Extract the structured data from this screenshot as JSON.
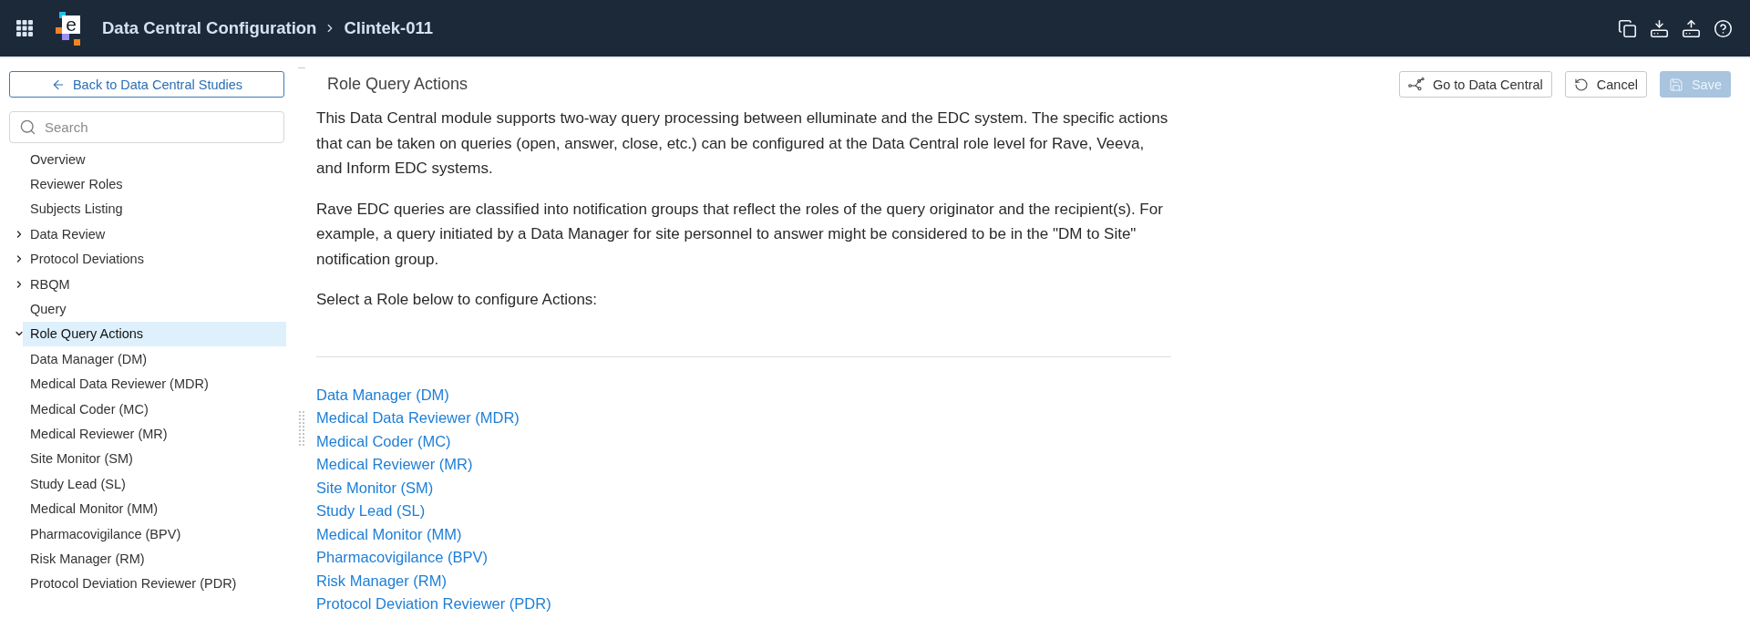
{
  "header": {
    "logo_letter": "e",
    "breadcrumb": [
      "Data Central Configuration",
      "Clintek-011"
    ]
  },
  "sidebar": {
    "back_button": "Back to Data Central Studies",
    "search": {
      "placeholder": "Search"
    },
    "nav": [
      {
        "label": "Overview",
        "kind": "link",
        "selected": false
      },
      {
        "label": "Reviewer Roles",
        "kind": "link",
        "selected": false
      },
      {
        "label": "Subjects Listing",
        "kind": "link",
        "selected": false
      },
      {
        "label": "Data Review",
        "kind": "group",
        "expanded": false,
        "selected": false
      },
      {
        "label": "Protocol Deviations",
        "kind": "group",
        "expanded": false,
        "selected": false
      },
      {
        "label": "RBQM",
        "kind": "group",
        "expanded": false,
        "selected": false
      },
      {
        "label": "Query",
        "kind": "link",
        "selected": false
      },
      {
        "label": "Role Query Actions",
        "kind": "group",
        "expanded": true,
        "selected": true,
        "children": [
          {
            "label": "Data Manager (DM)",
            "selected": false
          },
          {
            "label": "Medical Data Reviewer (MDR)",
            "selected": false
          },
          {
            "label": "Medical Coder (MC)",
            "selected": false
          },
          {
            "label": "Medical Reviewer (MR)",
            "selected": false
          },
          {
            "label": "Site Monitor (SM)",
            "selected": false
          },
          {
            "label": "Study Lead (SL)",
            "selected": false
          },
          {
            "label": "Medical Monitor (MM)",
            "selected": false
          },
          {
            "label": "Pharmacovigilance (BPV)",
            "selected": false
          },
          {
            "label": "Risk Manager (RM)",
            "selected": false
          },
          {
            "label": "Protocol Deviation Reviewer (PDR)",
            "selected": false
          }
        ]
      }
    ]
  },
  "main": {
    "title": "Role Query Actions",
    "actions": [
      {
        "label": "Go to Data Central",
        "kind": "outline",
        "disabled": false
      },
      {
        "label": "Cancel",
        "kind": "outline",
        "disabled": false
      },
      {
        "label": "Save",
        "kind": "primary",
        "disabled": true
      }
    ],
    "paragraphs": [
      "This Data Central module supports two-way query processing between elluminate and the EDC system. The specific actions that can be taken on queries (open, answer, close, etc.) can be configured at the Data Central role level for Rave, Veeva, and Inform EDC systems.",
      "Rave EDC queries are classified into notification groups that reflect the roles of the query originator and the recipient(s). For example, a query initiated by a Data Manager for site personnel to answer might be considered to be in the \"DM to Site\" notification group.",
      "Select a Role below to configure Actions:"
    ],
    "role_links": [
      "Data Manager (DM)",
      "Medical Data Reviewer (MDR)",
      "Medical Coder (MC)",
      "Medical Reviewer (MR)",
      "Site Monitor (SM)",
      "Study Lead (SL)",
      "Medical Monitor (MM)",
      "Pharmacovigilance (BPV)",
      "Risk Manager (RM)",
      "Protocol Deviation Reviewer (PDR)"
    ]
  }
}
